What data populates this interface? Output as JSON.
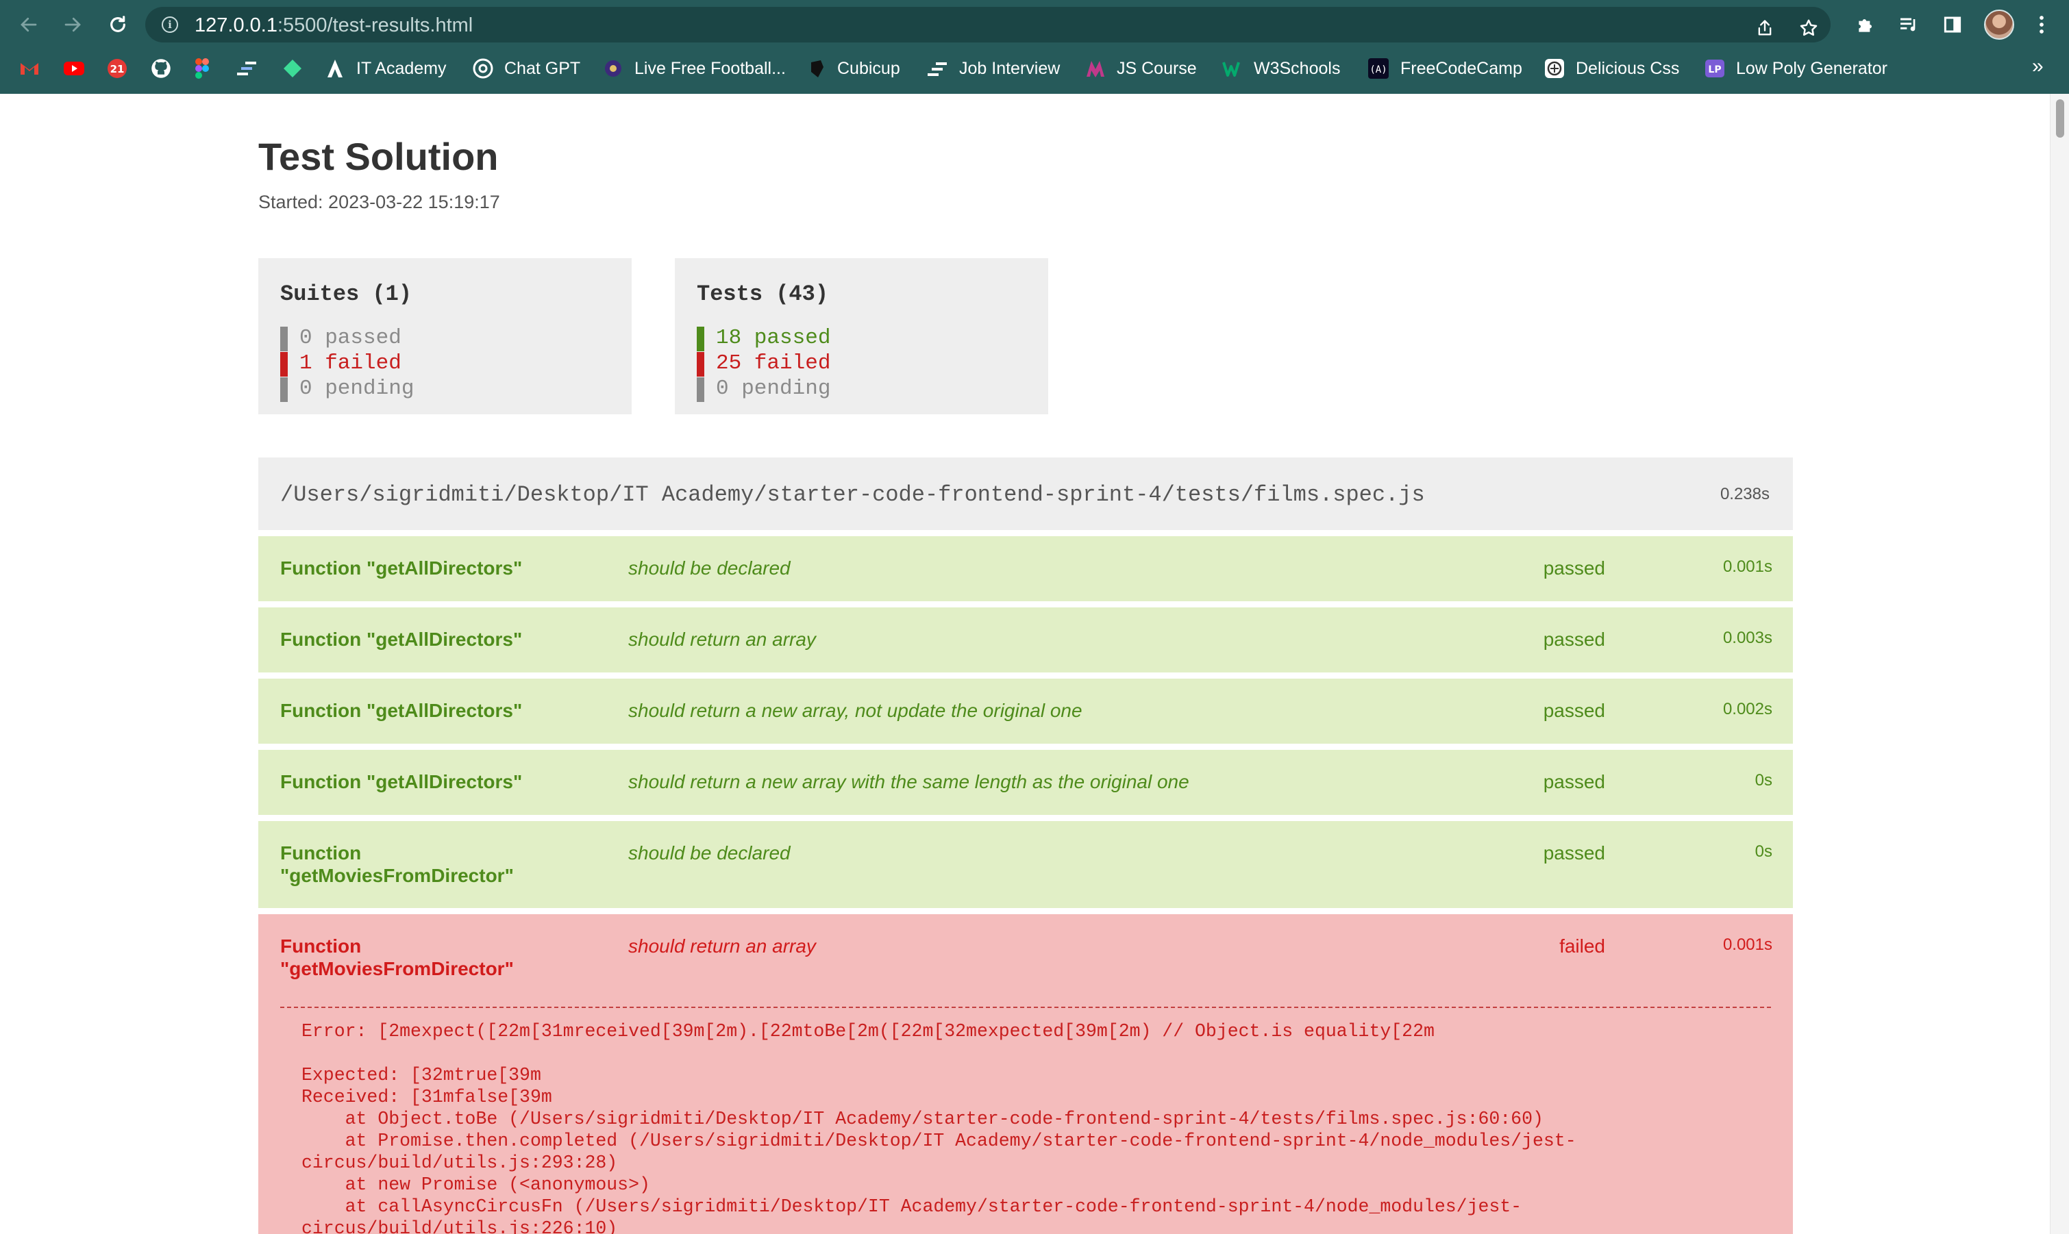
{
  "browser": {
    "url_host": "127.0.0.1",
    "url_path": ":5500/test-results.html",
    "bookmarks": [
      {
        "label": "",
        "icon": "gmail-icon",
        "color": "#ea4335"
      },
      {
        "label": "",
        "icon": "youtube-icon",
        "color": "#ff0000"
      },
      {
        "label": "",
        "icon": "calendar-icon",
        "color": "#1a73e8",
        "text": "21"
      },
      {
        "label": "",
        "icon": "github-icon",
        "color": "#ffffff"
      },
      {
        "label": "",
        "icon": "figma-icon",
        "color": "#f24e1e"
      },
      {
        "label": "",
        "icon": "bars-icon",
        "color": "#8ab4f8"
      },
      {
        "label": "",
        "icon": "diamond-icon",
        "color": "#3ddc97"
      },
      {
        "label": "IT Academy",
        "icon": "it-academy-icon",
        "color": "#ffffff"
      },
      {
        "label": "Chat GPT",
        "icon": "chatgpt-icon",
        "color": "#ffffff"
      },
      {
        "label": "Live Free Football...",
        "icon": "football-icon",
        "color": "#3c2a7a"
      },
      {
        "label": "Cubicup",
        "icon": "cubicup-icon",
        "color": "#111111"
      },
      {
        "label": "Job Interview",
        "icon": "job-interview-icon",
        "color": "#1e1e3c"
      },
      {
        "label": "JS Course",
        "icon": "js-course-icon",
        "color": "#c0398a"
      },
      {
        "label": "W3Schools",
        "icon": "w3schools-icon",
        "color": "#04aa6d"
      },
      {
        "label": "FreeCodeCamp",
        "icon": "freecodecamp-icon",
        "color": "#0a0a23"
      },
      {
        "label": "Delicious Css",
        "icon": "delicious-css-icon",
        "color": "#ffffff"
      },
      {
        "label": "Low Poly Generator",
        "icon": "low-poly-icon",
        "color": "#7b5cd6"
      }
    ]
  },
  "report": {
    "title": "Test Solution",
    "started": "Started: 2023-03-22 15:19:17"
  },
  "suites_summary": {
    "heading": "Suites (1)",
    "passed": "0 passed",
    "failed": "1 failed",
    "pending": "0 pending"
  },
  "tests_summary": {
    "heading": "Tests (43)",
    "passed": "18 passed",
    "failed": "25 failed",
    "pending": "0 pending"
  },
  "colors": {
    "passed": "#4e8b1b",
    "failed": "#d11b1b",
    "pending": "#8a8a8a",
    "passed_bg": "#e1efc6",
    "failed_bg": "#f4bcbc",
    "chrome": "#265a5a"
  },
  "suite": {
    "path": "/Users/sigridmiti/Desktop/IT Academy/starter-code-frontend-sprint-4/tests/films.spec.js",
    "time": "0.238s",
    "tests": [
      {
        "suite": "Function \"getAllDirectors\"",
        "description": "should be declared",
        "status": "passed",
        "time": "0.001s"
      },
      {
        "suite": "Function \"getAllDirectors\"",
        "description": "should return an array",
        "status": "passed",
        "time": "0.003s"
      },
      {
        "suite": "Function \"getAllDirectors\"",
        "description": "should return a new array, not update the original one",
        "status": "passed",
        "time": "0.002s"
      },
      {
        "suite": "Function \"getAllDirectors\"",
        "description": "should return a new array with the same length as the original one",
        "status": "passed",
        "time": "0s"
      },
      {
        "suite": "Function \"getMoviesFromDirector\"",
        "description": "should be declared",
        "status": "passed",
        "time": "0s"
      },
      {
        "suite": "Function \"getMoviesFromDirector\"",
        "description": "should return an array",
        "status": "failed",
        "time": "0.001s",
        "error": "Error: [2mexpect([22m[31mreceived[39m[2m).[22mtoBe[2m([22m[32mexpected[39m[2m) // Object.is equality[22m\n\nExpected: [32mtrue[39m\nReceived: [31mfalse[39m\n    at Object.toBe (/Users/sigridmiti/Desktop/IT Academy/starter-code-frontend-sprint-4/tests/films.spec.js:60:60)\n    at Promise.then.completed (/Users/sigridmiti/Desktop/IT Academy/starter-code-frontend-sprint-4/node_modules/jest-\ncircus/build/utils.js:293:28)\n    at new Promise (<anonymous>)\n    at callAsyncCircusFn (/Users/sigridmiti/Desktop/IT Academy/starter-code-frontend-sprint-4/node_modules/jest-\ncircus/build/utils.js:226:10)"
      }
    ]
  }
}
